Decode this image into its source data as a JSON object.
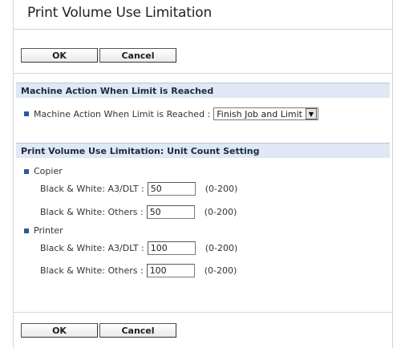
{
  "page": {
    "title": "Print Volume Use Limitation"
  },
  "buttons": {
    "ok_label": "OK",
    "cancel_label": "Cancel"
  },
  "machine_action": {
    "section_title": "Machine Action When Limit is Reached",
    "field_label": "Machine Action When Limit is Reached :",
    "selected_value": "Finish Job and Limit"
  },
  "unit_count": {
    "section_title": "Print Volume Use Limitation: Unit Count Setting",
    "groups": [
      {
        "name": "Copier",
        "rows": [
          {
            "label": "Black & White: A3/DLT :",
            "value": "50",
            "range": "(0-200)"
          },
          {
            "label": "Black & White: Others :",
            "value": "50",
            "range": "(0-200)"
          }
        ]
      },
      {
        "name": "Printer",
        "rows": [
          {
            "label": "Black & White: A3/DLT :",
            "value": "100",
            "range": "(0-200)"
          },
          {
            "label": "Black & White: Others :",
            "value": "100",
            "range": "(0-200)"
          }
        ]
      }
    ]
  },
  "colors": {
    "section_header_bg": "#dfe8f4",
    "bullet": "#2b5a9a"
  },
  "icons": {
    "select_arrow": "chevron-down-icon",
    "bullet": "square-bullet-icon"
  }
}
